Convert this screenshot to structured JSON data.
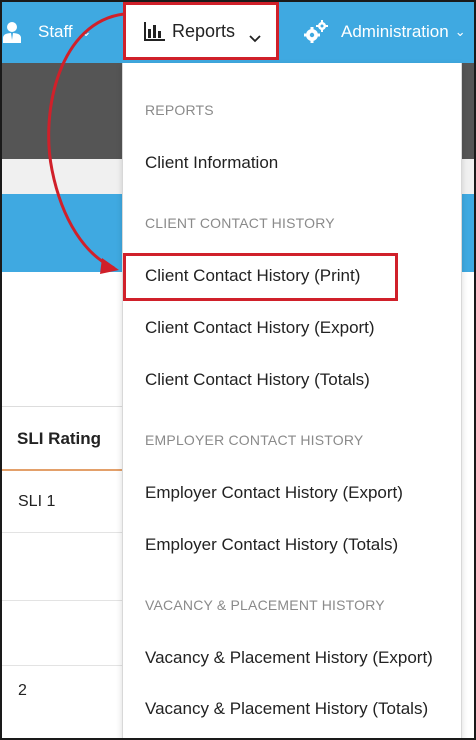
{
  "nav": {
    "staff_label": "Staff",
    "reports_label": "Reports",
    "admin_label": "Administration"
  },
  "table": {
    "header": "SLI Rating",
    "rows": [
      "SLI 1",
      "",
      "",
      "2"
    ]
  },
  "dropdown": {
    "sections": [
      {
        "header": "REPORTS",
        "items": [
          "Client Information"
        ]
      },
      {
        "header": "CLIENT CONTACT HISTORY",
        "items": [
          "Client Contact History (Print)",
          "Client Contact History (Export)",
          "Client Contact History (Totals)"
        ]
      },
      {
        "header": "EMPLOYER CONTACT HISTORY",
        "items": [
          "Employer Contact History (Export)",
          "Employer Contact History (Totals)"
        ]
      },
      {
        "header": "VACANCY & PLACEMENT HISTORY",
        "items": [
          "Vacancy & Placement History (Export)",
          "Vacancy & Placement History (Totals)"
        ]
      }
    ]
  },
  "colors": {
    "nav_blue": "#3fa9e1",
    "highlight_red": "#d0202a"
  },
  "icons": {
    "staff": "person-icon",
    "reports": "bar-chart-icon",
    "admin": "gears-icon"
  }
}
